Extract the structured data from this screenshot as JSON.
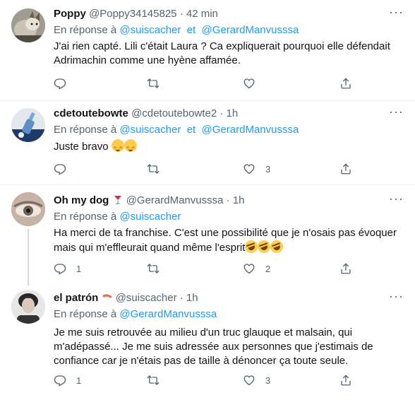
{
  "tweets": [
    {
      "name": "Poppy",
      "handle": "@Poppy34145825",
      "time": "42 min",
      "reply_prefix": "En réponse à",
      "mention_1": "@suiscacher",
      "mention_joiner": "et",
      "mention_2": "@GerardManvusssa",
      "text_line_1": "J'ai rien capté. Lili c'était Laura ? Ca expliquerait pourquoi elle défendait",
      "text_line_2": "Adrimachin comme une hyène affamée.",
      "replies": "",
      "retweets": "",
      "likes": ""
    },
    {
      "name": "cdetoutebowte",
      "handle": "@cdetoutebowte2",
      "time": "1h",
      "reply_prefix": "En réponse à",
      "mention_1": "@suiscacher",
      "mention_joiner": "et",
      "mention_2": "@GerardManvusssa",
      "text_line_1": "Juste bravo",
      "replies": "",
      "retweets": "",
      "likes": "3"
    },
    {
      "name": "Oh my dog",
      "handle": "@GerardManvusssa",
      "time": "1h",
      "reply_prefix": "En réponse à",
      "mention_1": "@suiscacher",
      "text_line_1": "Ha merci de ta franchise. C'est une possibilité que je n'osais pas évoquer",
      "text_line_2": "mais qui m'effleurait quand même l'esprit",
      "replies": "1",
      "retweets": "",
      "likes": "2"
    },
    {
      "name": "el patrón",
      "handle": "@suiscacher",
      "time": "1h",
      "reply_prefix": "En réponse à",
      "mention_1": "@GerardManvusssa",
      "text_line_1": "Je me suis retrouvée au milieu d'un truc glauque et malsain, qui",
      "text_line_2": "m'adépassé... Je me suis adressée aux personnes que j'estimais de",
      "text_line_3": "confiance car je n'étais pas de taille à dénoncer ça toute seule.",
      "replies": "1",
      "retweets": "",
      "likes": "3"
    }
  ],
  "ui": {
    "dot": "·",
    "more": "···"
  },
  "colors": {
    "accent": "#1d9bf0",
    "secondary": "#536471",
    "text": "#0f1419"
  }
}
